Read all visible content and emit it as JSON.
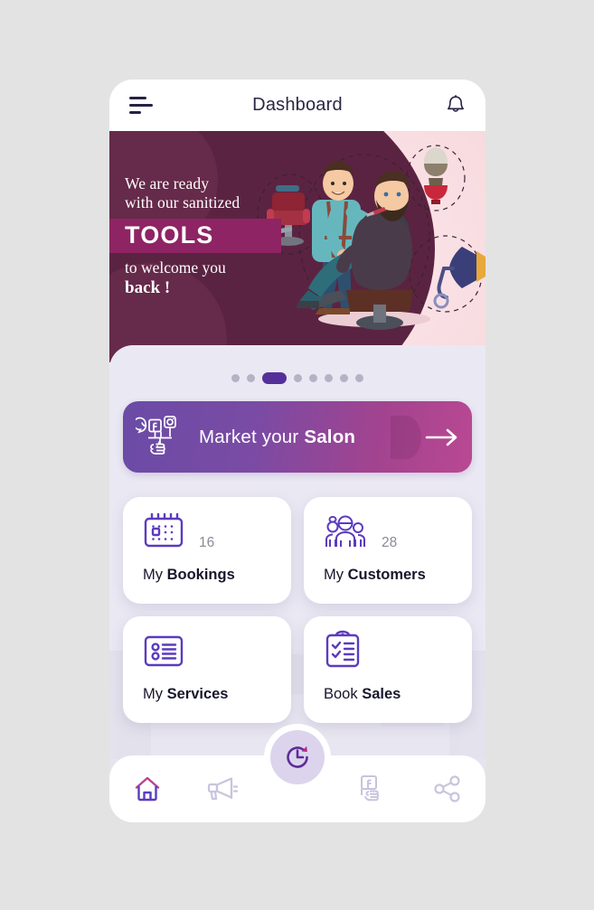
{
  "header": {
    "title": "Dashboard",
    "menu_icon": "hamburger-menu-icon",
    "notification_icon": "bell-icon"
  },
  "banner": {
    "line1": "We are ready",
    "line2": "with our sanitized",
    "highlight": "TOOLS",
    "line3": "to welcome you",
    "line4": "back !",
    "artwork": "barber-shaving-client-illustration",
    "artwork_items": [
      "barber-chair",
      "shaving-brush",
      "hair-dryer"
    ]
  },
  "carousel": {
    "total_dots": 8,
    "active_index": 2
  },
  "market_banner": {
    "text_light": "Market your ",
    "text_bold": "Salon",
    "icon": "social-media-megaphone-icon",
    "social_icons": [
      "whatsapp",
      "facebook",
      "instagram"
    ],
    "arrow_icon": "arrow-right-icon"
  },
  "tiles": [
    {
      "label_light": "My ",
      "label_bold": "Bookings",
      "count": "16",
      "icon": "calendar-icon"
    },
    {
      "label_light": "My ",
      "label_bold": "Customers",
      "count": "28",
      "icon": "customers-group-icon"
    },
    {
      "label_light": "My ",
      "label_bold": "Services",
      "count": "",
      "icon": "list-details-icon"
    },
    {
      "label_light": "Book ",
      "label_bold": "Sales",
      "count": "",
      "icon": "clipboard-check-icon"
    }
  ],
  "bottom_nav": {
    "items": [
      {
        "name": "home",
        "icon": "home-icon",
        "active": true
      },
      {
        "name": "promotions",
        "icon": "megaphone-icon",
        "active": false
      },
      {
        "name": "history",
        "icon": "clock-refresh-icon",
        "active": false
      },
      {
        "name": "payments",
        "icon": "hand-holding-card-icon",
        "active": false
      },
      {
        "name": "share",
        "icon": "share-nodes-icon",
        "active": false
      }
    ]
  },
  "colors": {
    "brand_purple": "#55309b",
    "brand_magenta": "#b8458f",
    "plum_dark": "#5b2342",
    "plum_mid": "#8e2464",
    "sheet_bg": "#eae8f3",
    "page_bg": "#e3e3e3",
    "icon_purple": "#5b3bbf",
    "nav_inactive": "#c9c4dd",
    "text_dark": "#17172b",
    "count_gray": "#8b8b99"
  }
}
